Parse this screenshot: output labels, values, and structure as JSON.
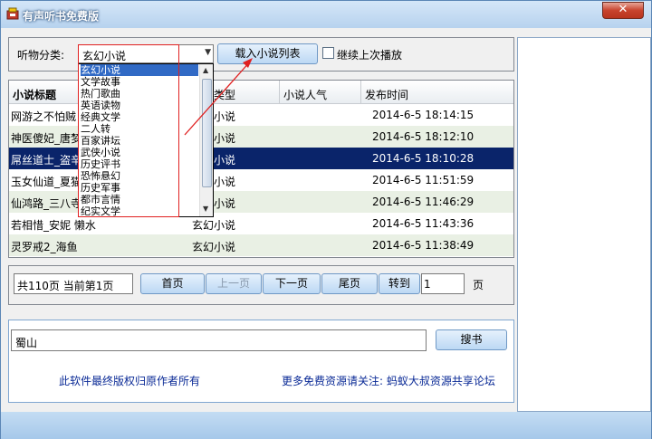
{
  "window": {
    "title": "有声听书免费版",
    "close_label": "✕"
  },
  "controls": {
    "category_label": "听物分类:",
    "category_selected": "玄幻小说",
    "load_button": "载入小说列表",
    "resume_label": "继续上次播放"
  },
  "dropdown": {
    "options": [
      "玄幻小说",
      "文学故事",
      "热门歌曲",
      "英语读物",
      "经典文学",
      "二人转",
      "百家讲坛",
      "武侠小说",
      "历史评书",
      "恐怖悬幻",
      "历史军事",
      "都市言情",
      "纪实文学"
    ]
  },
  "table": {
    "columns": [
      "小说标题",
      "类型",
      "小说人气",
      "发布时间"
    ],
    "rows": [
      {
        "title": "网游之不怕贼",
        "type": "小说",
        "pop": "",
        "time": "2014-6-5 18:14:15"
      },
      {
        "title": "神医傻妃_唐梦",
        "type": "小说",
        "pop": "",
        "time": "2014-6-5 18:12:10"
      },
      {
        "title": "屌丝道士_盗辛",
        "type": "小说",
        "pop": "",
        "time": "2014-6-5 18:10:28"
      },
      {
        "title": "玉女仙道_夏猫",
        "type": "小说",
        "pop": "",
        "time": "2014-6-5 11:51:59"
      },
      {
        "title": "仙鸿路_三八寺",
        "type": "小说",
        "pop": "",
        "time": "2014-6-5 11:46:29"
      },
      {
        "title": "若相惜_安妮 懒水",
        "type": "玄幻小说",
        "pop": "",
        "time": "2014-6-5 11:43:36"
      },
      {
        "title": "灵罗戒2_海鱼",
        "type": "玄幻小说",
        "pop": "",
        "time": "2014-6-5 11:38:49"
      }
    ]
  },
  "pager": {
    "info": "共110页   当前第1页",
    "first": "首页",
    "prev": "上一页",
    "next": "下一页",
    "last": "尾页",
    "goto": "转到",
    "page_value": "1",
    "unit": "页"
  },
  "search": {
    "value": "蜀山",
    "button": "搜书"
  },
  "footer": {
    "copyright": "此软件最终版权归原作者所有",
    "promo": "更多免费资源请关注: 蚂蚁大叔资源共享论坛"
  }
}
